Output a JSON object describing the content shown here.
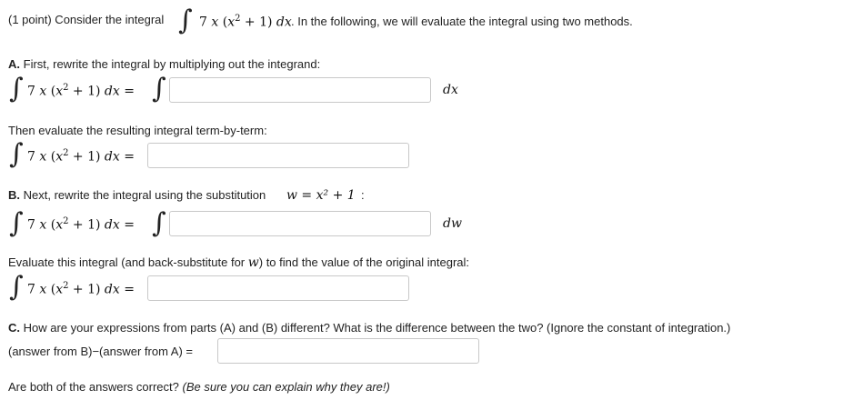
{
  "header": {
    "points": "(1 point) Consider the integral",
    "tail": ". In the following, we will evaluate the integral using two methods."
  },
  "integrand": "7 x (x² + 1) dx",
  "partA": {
    "letter": "A.",
    "prompt": "First, rewrite the integral by multiplying out the integrand:",
    "differential": "dx",
    "evaluate_prompt": "Then evaluate the resulting integral term-by-term:",
    "answer1": "",
    "answer2": ""
  },
  "partB": {
    "letter": "B.",
    "prompt": "Next, rewrite the integral using the substitution",
    "substitution": "w = x² + 1",
    "colon": ":",
    "differential": "dw",
    "evaluate_prompt_start": "Evaluate this integral (and back-substitute for",
    "evaluate_var": "w",
    "evaluate_prompt_end": ") to find the value of the original integral:",
    "answer1": "",
    "answer2": ""
  },
  "partC": {
    "letter": "C.",
    "prompt": "How are your expressions from parts (A) and (B) different? What is the difference between the two? (Ignore the constant of integration.)",
    "difference_label": "(answer from B)−(answer from A) =",
    "answer": "",
    "final_question": "Are both of the answers correct?",
    "final_hint": "(Be sure you can explain why they are!)"
  }
}
